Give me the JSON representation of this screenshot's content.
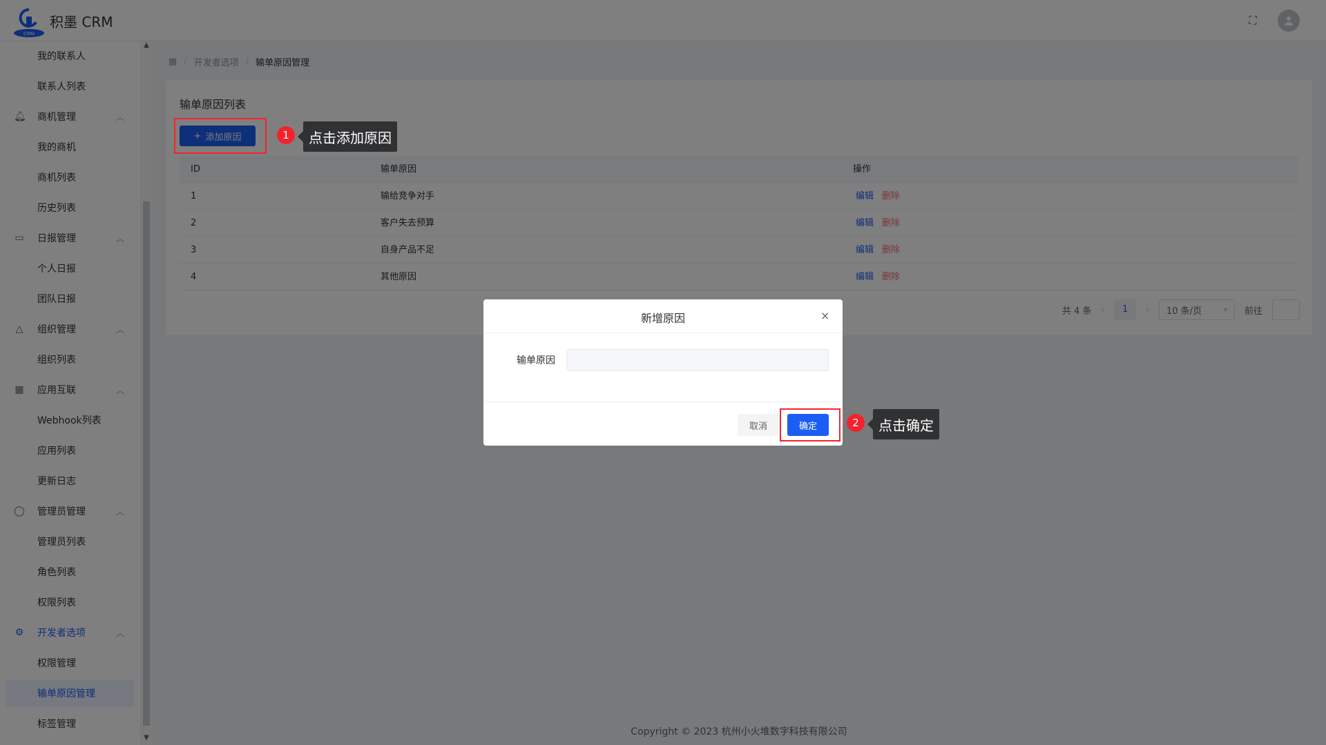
{
  "app": {
    "title": "积墨 CRM",
    "logo_caption": "CRM"
  },
  "sidebar": {
    "items": [
      {
        "label": "我的联系人",
        "type": "sub"
      },
      {
        "label": "联系人列表",
        "type": "sub"
      },
      {
        "label": "商机管理",
        "type": "group",
        "icon": "bell-icon"
      },
      {
        "label": "我的商机",
        "type": "sub"
      },
      {
        "label": "商机列表",
        "type": "sub"
      },
      {
        "label": "历史列表",
        "type": "sub"
      },
      {
        "label": "日报管理",
        "type": "group",
        "icon": "calendar-icon"
      },
      {
        "label": "个人日报",
        "type": "sub"
      },
      {
        "label": "团队日报",
        "type": "sub"
      },
      {
        "label": "组织管理",
        "type": "group",
        "icon": "organization-icon"
      },
      {
        "label": "组织列表",
        "type": "sub"
      },
      {
        "label": "应用互联",
        "type": "group",
        "icon": "grid-icon"
      },
      {
        "label": "Webhook列表",
        "type": "sub"
      },
      {
        "label": "应用列表",
        "type": "sub"
      },
      {
        "label": "更新日志",
        "type": "sub"
      },
      {
        "label": "管理员管理",
        "type": "group",
        "icon": "user-icon"
      },
      {
        "label": "管理员列表",
        "type": "sub"
      },
      {
        "label": "角色列表",
        "type": "sub"
      },
      {
        "label": "权限列表",
        "type": "sub"
      },
      {
        "label": "开发者选项",
        "type": "group",
        "icon": "gear-icon",
        "active": true
      },
      {
        "label": "权限管理",
        "type": "sub"
      },
      {
        "label": "输单原因管理",
        "type": "sub",
        "selected": true
      },
      {
        "label": "标签管理",
        "type": "sub"
      }
    ]
  },
  "breadcrumb": {
    "home_icon": "grid-icon",
    "items": [
      "开发者选项",
      "输单原因管理"
    ]
  },
  "card": {
    "title": "输单原因列表",
    "add_button": "添加原因"
  },
  "table": {
    "headers": [
      "ID",
      "输单原因",
      "操作"
    ],
    "rows": [
      {
        "id": "1",
        "reason": "输给竞争对手",
        "edit": "编辑",
        "delete": "删除"
      },
      {
        "id": "2",
        "reason": "客户失去预算",
        "edit": "编辑",
        "delete": "删除"
      },
      {
        "id": "3",
        "reason": "自身产品不足",
        "edit": "编辑",
        "delete": "删除"
      },
      {
        "id": "4",
        "reason": "其他原因",
        "edit": "编辑",
        "delete": "删除"
      }
    ]
  },
  "pagination": {
    "total": "共 4 条",
    "page": "1",
    "page_size": "10 条/页",
    "goto": "前往"
  },
  "footer": {
    "copyright": "Copyright © 2023 杭州小火堆数字科技有限公司"
  },
  "modal": {
    "title": "新增原因",
    "field_label": "输单原因",
    "field_value": "",
    "cancel": "取消",
    "confirm": "确定"
  },
  "callouts": [
    {
      "number": "1",
      "text": "点击添加原因"
    },
    {
      "number": "2",
      "text": "点击确定"
    }
  ],
  "colors": {
    "primary": "#1c5ef3",
    "danger": "#f56c6c",
    "callout": "#f5222d"
  }
}
